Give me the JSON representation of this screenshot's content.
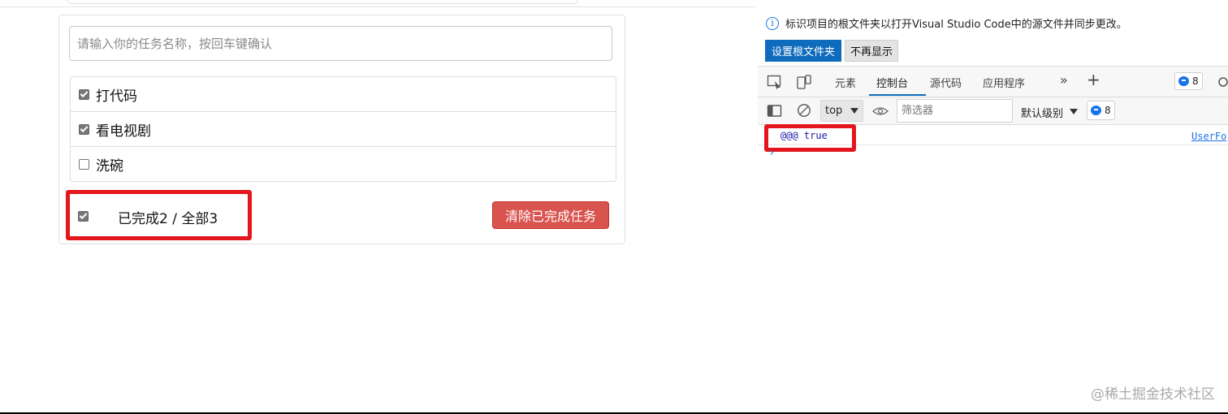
{
  "todo": {
    "input_placeholder": "请输入你的任务名称，按回车键确认",
    "items": [
      {
        "label": "打代码",
        "done": true
      },
      {
        "label": "看电视剧",
        "done": true
      },
      {
        "label": "洗碗",
        "done": false
      }
    ],
    "footer": {
      "all_checked": true,
      "summary": "已完成2 / 全部3",
      "clear_button": "清除已完成任务"
    }
  },
  "devtools": {
    "info_message": "标识项目的根文件夹以打开Visual Studio Code中的源文件并同步更改。",
    "set_root_button": "设置根文件夹",
    "dismiss_button": "不再显示",
    "tabs": [
      {
        "label": "元素",
        "active": false
      },
      {
        "label": "控制台",
        "active": true
      },
      {
        "label": "源代码",
        "active": false
      },
      {
        "label": "应用程序",
        "active": false
      }
    ],
    "issues_count": "8",
    "context_select": "top",
    "filter_placeholder": "筛选器",
    "level_label": "默认级别",
    "console_issues_count": "8",
    "console_line": {
      "message": "@@@ true",
      "source": "UserFo"
    }
  },
  "watermark": "@稀土掘金技术社区",
  "colors": {
    "highlight_red": "#e3161e",
    "danger_button": "#d9534f",
    "devtools_primary": "#0f6cbd"
  }
}
